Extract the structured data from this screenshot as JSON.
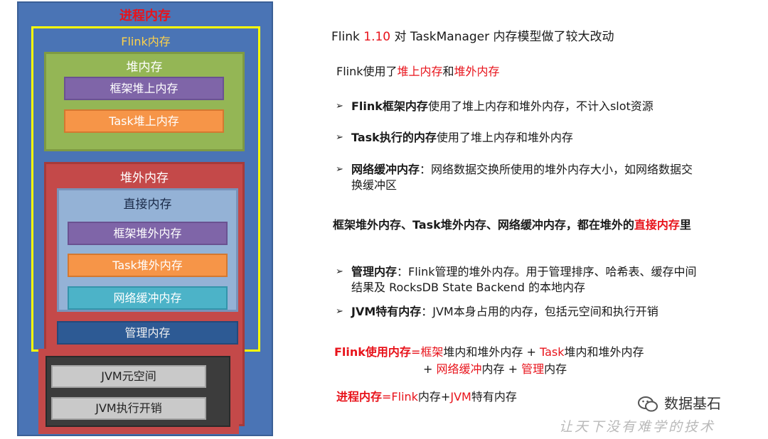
{
  "diagram": {
    "process_title": "进程内存",
    "flink_title": "Flink内存",
    "heap": {
      "title": "堆内存",
      "items": [
        "框架堆上内存",
        "Task堆上内存"
      ]
    },
    "offheap": {
      "title": "堆外内存"
    },
    "direct": {
      "title": "直接内存",
      "items": [
        "框架堆外内存",
        "Task堆外内存",
        "网络缓冲内存"
      ]
    },
    "managed": "管理内存",
    "jvm": {
      "items": [
        "JVM元空间",
        "JVM执行开销"
      ]
    }
  },
  "text": {
    "headline": {
      "pre": "Flink ",
      "version": "1.10",
      "post": " 对 TaskManager 内存模型做了较大改动"
    },
    "usage": {
      "a": "Flink使用了",
      "b": "堆上内存",
      "c": "和",
      "d": "堆外内存"
    },
    "bullet_glyph": "➢",
    "b1": {
      "bold": "Flink框架内存",
      "rest": "使用了堆上内存和堆外内存，不计入slot资源"
    },
    "b2": {
      "bold": "Task执行的内存",
      "rest": "使用了堆上内存和堆外内存"
    },
    "b3": {
      "bold": "网络缓冲内存",
      "rest": "：网络数据交换所使用的堆外内存大小，如网络数据交",
      "line2": "换缓冲区"
    },
    "summary": {
      "a": "框架堆外内存、Task堆外内存、网络缓冲内存，都在堆外的",
      "b": "直接内存",
      "c": "里"
    },
    "b4": {
      "bold": "管理内存",
      "rest": "：Flink管理的堆外内存。用于管理排序、哈希表、缓存中间",
      "line2": "结果及 RocksDB State Backend 的本地内存"
    },
    "b5": {
      "bold": "JVM特有内存",
      "rest": "：JVM本身占用的内存，包括元空间和执行开销"
    },
    "formula1": {
      "a": "Flink使用内存",
      "b": "=",
      "c": "框架",
      "d": "堆内和堆外内存 + ",
      "e": "Task",
      "f": "堆内和堆外内存"
    },
    "formula1_line2": {
      "a": "+ ",
      "b": "网络缓冲",
      "c": "内存 + ",
      "d": "管理",
      "e": "内存"
    },
    "formula2": {
      "a": "进程内存",
      "b": "=",
      "c": "Flink",
      "d": "内存+",
      "e": "JVM",
      "f": "特有内存"
    }
  },
  "watermark": {
    "name": "数据基石",
    "slogan": "让天下没有难学的技术"
  }
}
